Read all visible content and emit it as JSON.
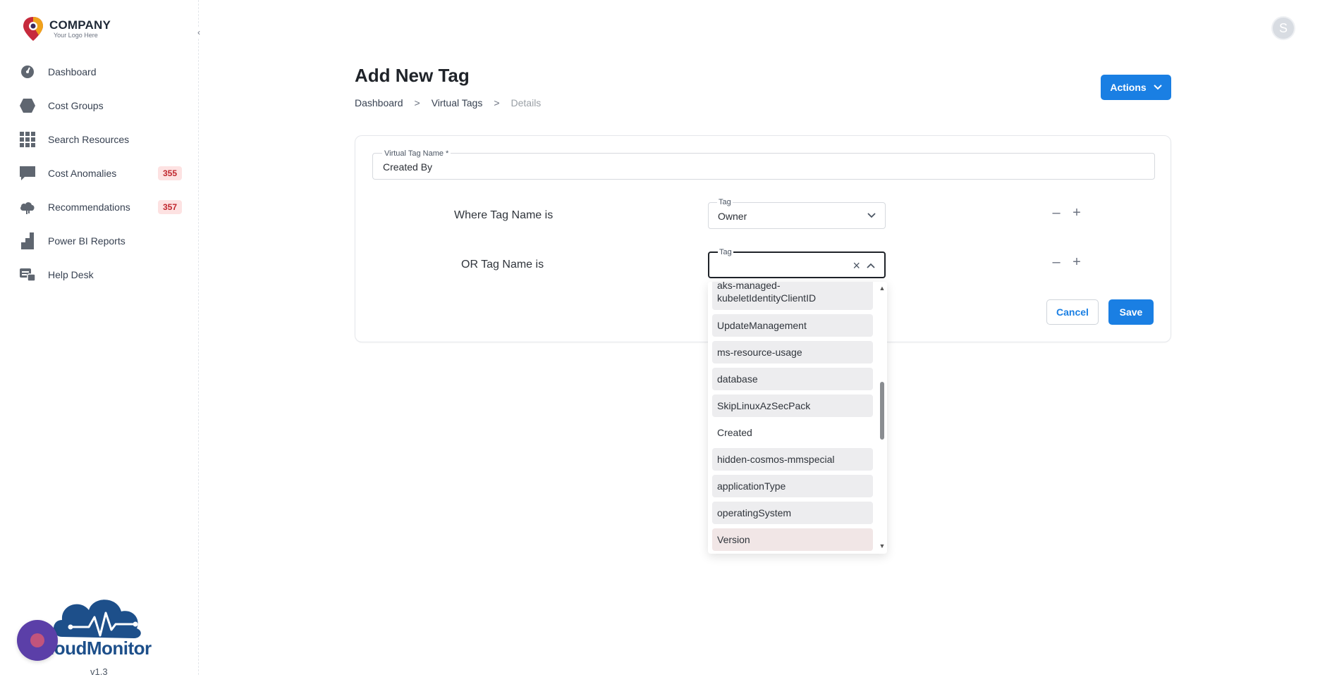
{
  "brand": {
    "name": "COMPANY",
    "tagline": "Your Logo Here"
  },
  "sidebar": {
    "items": [
      {
        "label": "Dashboard",
        "icon": "dashboard-icon",
        "badge": null
      },
      {
        "label": "Cost Groups",
        "icon": "hexagon-icon",
        "badge": null
      },
      {
        "label": "Search Resources",
        "icon": "grid-icon",
        "badge": null
      },
      {
        "label": "Cost Anomalies",
        "icon": "chat-icon",
        "badge": "355"
      },
      {
        "label": "Recommendations",
        "icon": "cloud-icon",
        "badge": "357"
      },
      {
        "label": "Power BI Reports",
        "icon": "bar-chart-icon",
        "badge": null
      },
      {
        "label": "Help Desk",
        "icon": "help-desk-icon",
        "badge": null
      }
    ],
    "footer_brand": "loudMonitor",
    "version": "v1.3"
  },
  "header": {
    "avatar_initial": "S"
  },
  "page": {
    "title": "Add New Tag",
    "breadcrumb": [
      "Dashboard",
      "Virtual Tags",
      "Details"
    ],
    "breadcrumb_sep": ">",
    "actions_label": "Actions"
  },
  "form": {
    "name_label": "Virtual Tag Name *",
    "name_value": "Created By",
    "rows": [
      {
        "label": "Where Tag Name is",
        "select_label": "Tag",
        "select_value": "Owner"
      },
      {
        "label": "OR Tag Name is",
        "select_label": "Tag",
        "select_value": ""
      }
    ],
    "cancel_label": "Cancel",
    "save_label": "Save"
  },
  "dropdown": {
    "options": [
      "aks-managed-kubeletIdentityClientID",
      "UpdateManagement",
      "ms-resource-usage",
      "database",
      "SkipLinuxAzSecPack",
      "Created",
      "hidden-cosmos-mmspecial",
      "applicationType",
      "operatingSystem",
      "Version"
    ]
  },
  "colors": {
    "primary": "#1a7fe3",
    "badge_bg": "#fde2e2",
    "badge_text": "#c0262d"
  }
}
